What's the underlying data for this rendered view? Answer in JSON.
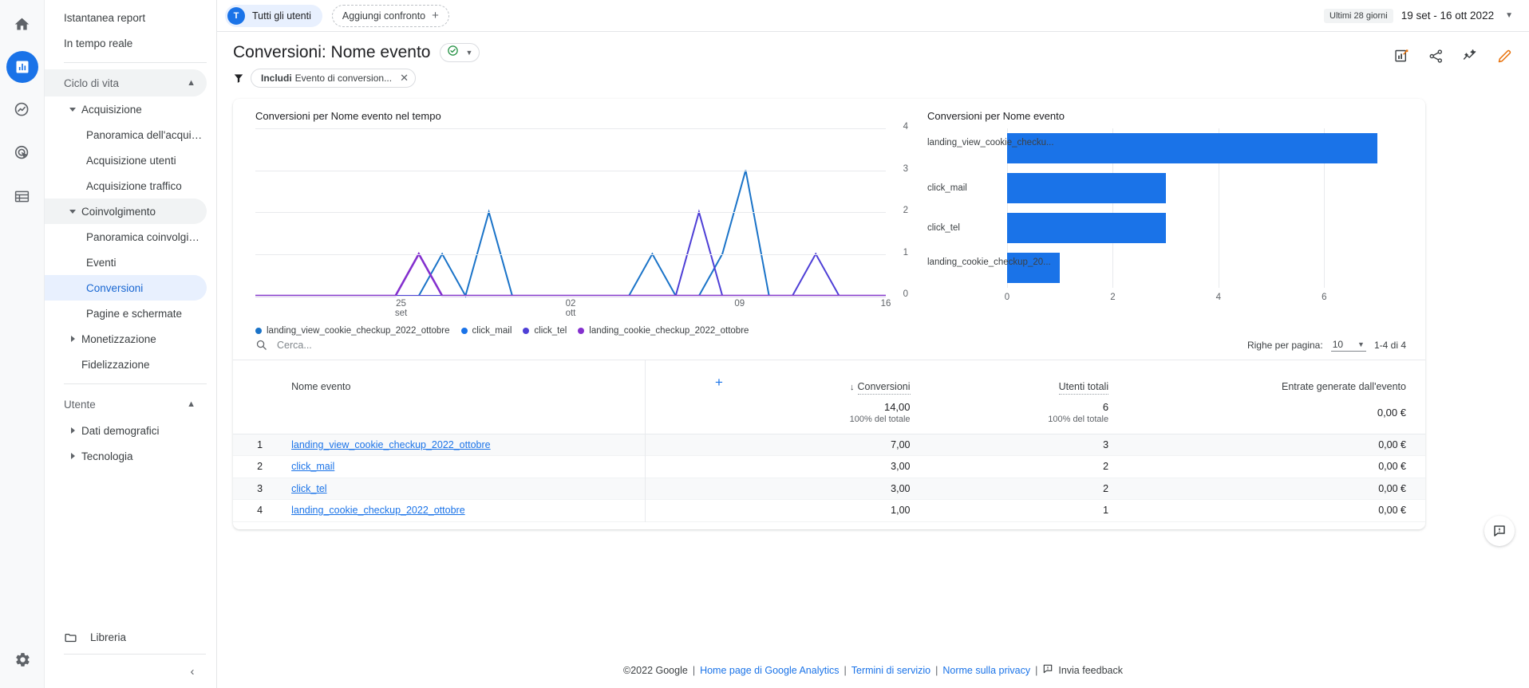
{
  "rail": {
    "items": [
      {
        "name": "home-icon",
        "label": "Home"
      },
      {
        "name": "reports-icon",
        "label": "Report",
        "active": true
      },
      {
        "name": "explore-icon",
        "label": "Esplora"
      },
      {
        "name": "advertising-icon",
        "label": "Pubblicità"
      },
      {
        "name": "library-icon",
        "label": "Libreria"
      }
    ],
    "settings_label": "Amministrazione"
  },
  "sidebar": {
    "top_items": [
      {
        "label": "Istantanea report"
      },
      {
        "label": "In tempo reale"
      }
    ],
    "sections": [
      {
        "label": "Ciclo di vita",
        "items": [
          {
            "label": "Acquisizione",
            "level": 1,
            "expanded": true
          },
          {
            "label": "Panoramica dell'acquisizio...",
            "level": 2
          },
          {
            "label": "Acquisizione utenti",
            "level": 2
          },
          {
            "label": "Acquisizione traffico",
            "level": 2
          },
          {
            "label": "Coinvolgimento",
            "level": 1,
            "expanded": true,
            "shaded": true
          },
          {
            "label": "Panoramica coinvolgimento",
            "level": 2
          },
          {
            "label": "Eventi",
            "level": 2
          },
          {
            "label": "Conversioni",
            "level": 2,
            "selected": true
          },
          {
            "label": "Pagine e schermate",
            "level": 2
          },
          {
            "label": "Monetizzazione",
            "level": 1,
            "collapsed": true
          },
          {
            "label": "Fidelizzazione",
            "level": 1,
            "noarrow": true
          }
        ]
      },
      {
        "label": "Utente",
        "items": [
          {
            "label": "Dati demografici",
            "level": 1,
            "collapsed": true
          },
          {
            "label": "Tecnologia",
            "level": 1,
            "collapsed": true
          }
        ]
      }
    ],
    "library_label": "Libreria",
    "collapse_label": "Comprimi menu di navigazione"
  },
  "topbar": {
    "audience_chip": {
      "avatar": "T",
      "label": "Tutti gli utenti"
    },
    "compare_label": "Aggiungi confronto",
    "compare_plus": "+",
    "date_badge": "Ultimi 28 giorni",
    "date_range": "19 set - 16 ott 2022"
  },
  "header": {
    "title": "Conversioni: Nome evento",
    "filter": {
      "prefix": "Includi",
      "text": "Evento di conversion..."
    },
    "icons": [
      {
        "name": "insights-icon",
        "label": "Statistiche"
      },
      {
        "name": "share-icon",
        "label": "Condividi questo report"
      },
      {
        "name": "compare-icon",
        "label": "Confronta"
      },
      {
        "name": "edit-icon",
        "label": "Modifica"
      }
    ]
  },
  "chart_data": [
    {
      "type": "line",
      "title": "Conversioni per Nome evento nel tempo",
      "xlabel": "",
      "ylabel": "",
      "ylim": [
        0,
        4
      ],
      "yticks": [
        "0",
        "1",
        "2",
        "3",
        "4"
      ],
      "xticks": [
        {
          "label": "25",
          "sub": "set",
          "pos": 0.231
        },
        {
          "label": "02",
          "sub": "ott",
          "pos": 0.5
        },
        {
          "label": "09",
          "sub": "",
          "pos": 0.768
        },
        {
          "label": "16",
          "sub": "",
          "pos": 1.0
        }
      ],
      "grid": true,
      "legend_position": "bottom",
      "series": [
        {
          "name": "landing_view_cookie_checkup_2022_ottobre",
          "color": "#1a73c8",
          "values": [
            0,
            0,
            0,
            0,
            0,
            0,
            0,
            0,
            1,
            0,
            2,
            0,
            0,
            0,
            0,
            0,
            0,
            1,
            0,
            0,
            1,
            3,
            0,
            0,
            0,
            0,
            0,
            0
          ]
        },
        {
          "name": "click_mail",
          "color": "#1a73e8",
          "values": [
            0,
            0,
            0,
            0,
            0,
            0,
            0,
            0,
            0,
            0,
            0,
            0,
            0,
            0,
            0,
            0,
            0,
            0,
            0,
            0,
            0,
            0,
            0,
            0,
            0,
            0,
            0,
            0
          ]
        },
        {
          "name": "click_tel",
          "color": "#4e3fd6",
          "values": [
            0,
            0,
            0,
            0,
            0,
            0,
            0,
            0,
            0,
            0,
            0,
            0,
            0,
            0,
            0,
            0,
            0,
            0,
            0,
            2,
            0,
            0,
            0,
            0,
            1,
            0,
            0,
            0
          ]
        },
        {
          "name": "landing_cookie_checkup_2022_ottobre",
          "color": "#8430ce",
          "values": [
            0,
            0,
            0,
            0,
            0,
            0,
            0,
            1,
            0,
            0,
            0,
            0,
            0,
            0,
            0,
            0,
            0,
            0,
            0,
            0,
            0,
            0,
            0,
            0,
            0,
            0,
            0,
            0
          ]
        }
      ]
    },
    {
      "type": "bar",
      "orientation": "horizontal",
      "title": "Conversioni per Nome evento",
      "categories": [
        "landing_view_cookie_checku...",
        "click_mail",
        "click_tel",
        "landing_cookie_checkup_20..."
      ],
      "values": [
        7,
        3,
        3,
        1
      ],
      "color": "#1a73e8",
      "xticks": [
        "0",
        "2",
        "4",
        "6"
      ],
      "xlim": [
        0,
        7.4
      ],
      "grid": true
    }
  ],
  "table": {
    "search_placeholder": "Cerca...",
    "search_value": "",
    "rows_per_page_label": "Righe per pagina:",
    "rows_per_page_value": "10",
    "range_label": "1-4 di 4",
    "columns": [
      {
        "key": "rank",
        "label": ""
      },
      {
        "key": "name",
        "label": "Nome evento"
      },
      {
        "key": "conversions",
        "label": "Conversioni",
        "sorted": true,
        "sort_dir": "desc"
      },
      {
        "key": "users",
        "label": "Utenti totali"
      },
      {
        "key": "revenue",
        "label": "Entrate generate dall'evento"
      }
    ],
    "add_dimension": "+",
    "totals": {
      "conversions": "14,00",
      "conversions_sub": "100% del totale",
      "users": "6",
      "users_sub": "100% del totale",
      "revenue": "0,00 €"
    },
    "rows": [
      {
        "rank": "1",
        "name": "landing_view_cookie_checkup_2022_ottobre",
        "conversions": "7,00",
        "users": "3",
        "revenue": "0,00 €"
      },
      {
        "rank": "2",
        "name": "click_mail",
        "conversions": "3,00",
        "users": "2",
        "revenue": "0,00 €"
      },
      {
        "rank": "3",
        "name": "click_tel",
        "conversions": "3,00",
        "users": "2",
        "revenue": "0,00 €"
      },
      {
        "rank": "4",
        "name": "landing_cookie_checkup_2022_ottobre",
        "conversions": "1,00",
        "users": "1",
        "revenue": "0,00 €"
      }
    ]
  },
  "footer": {
    "copyright": "©2022 Google",
    "links": [
      "Home page di Google Analytics",
      "Termini di servizio",
      "Norme sulla privacy"
    ],
    "feedback": "Invia feedback"
  },
  "colors": {
    "accent": "#1a73e8",
    "selected_bg": "#e8f0fe",
    "selected_text": "#1967d2",
    "series1": "#1a73c8",
    "series2": "#1a73e8",
    "series3": "#4e3fd6",
    "series4": "#8430ce"
  }
}
